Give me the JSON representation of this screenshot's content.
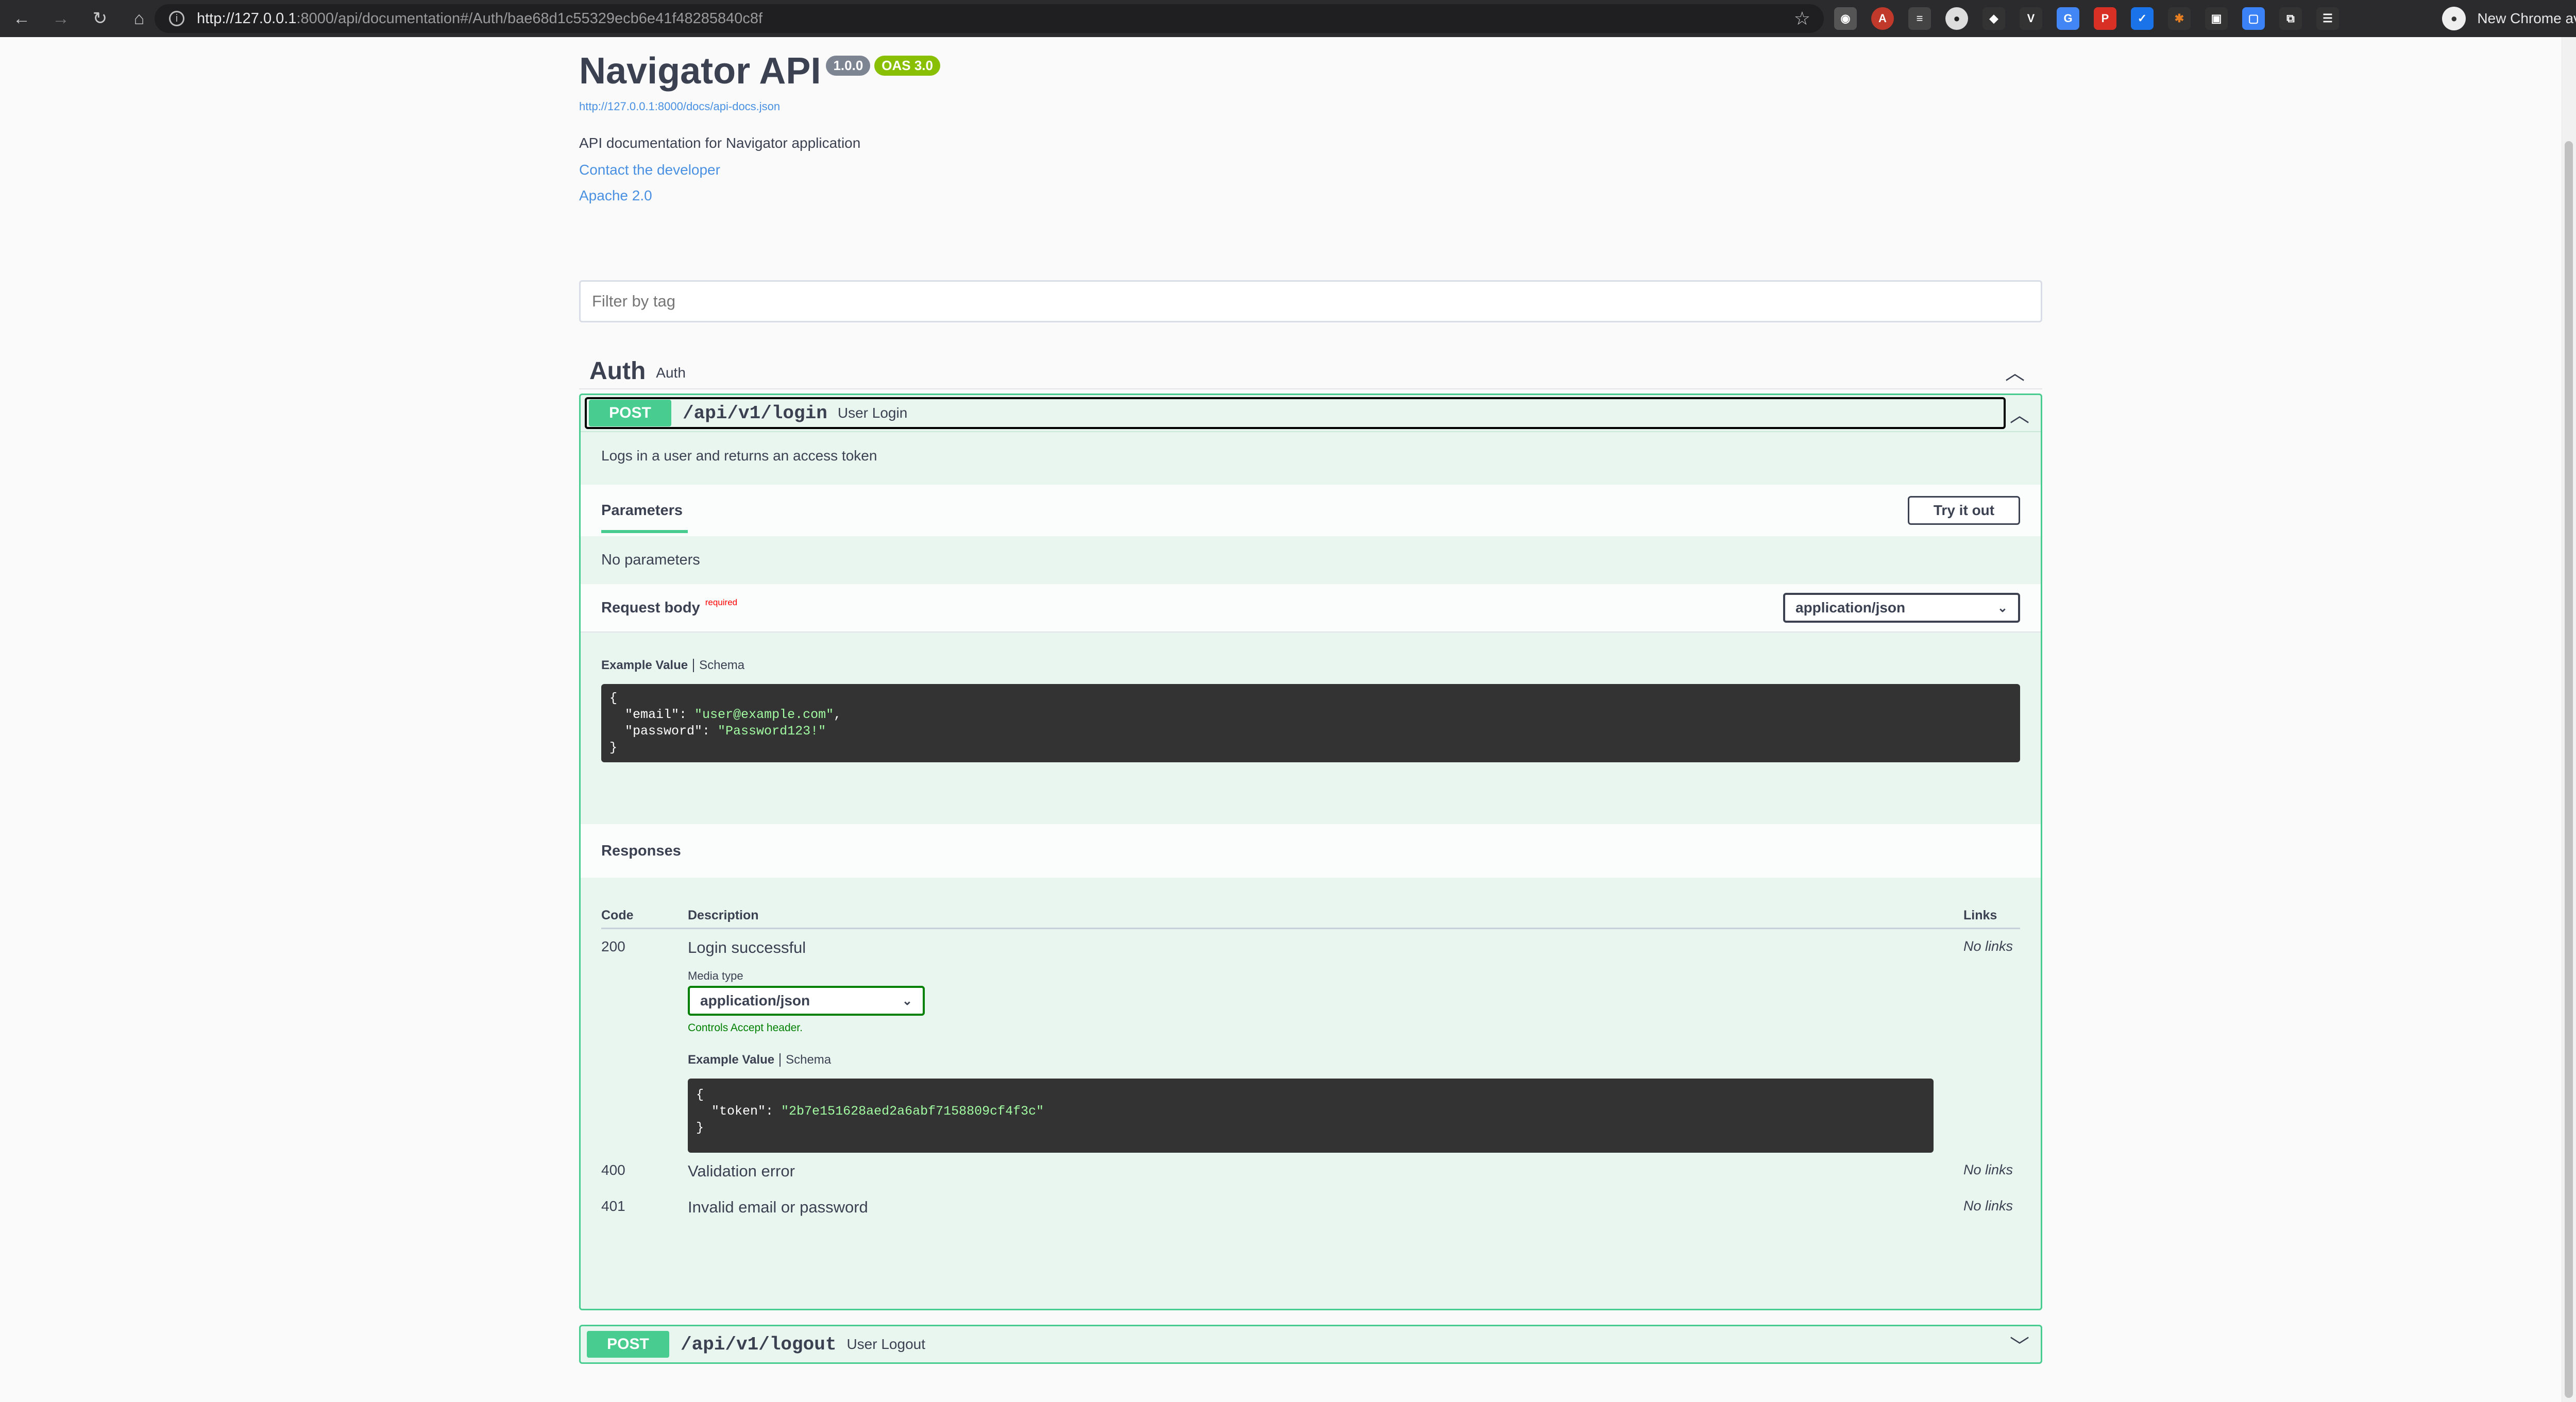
{
  "browser": {
    "url_host": "http://127.0.0.1",
    "url_rest": ":8000/api/documentation#/Auth/bae68d1c55329ecb6e41f48285840c8f",
    "new_chrome": "New Chrome available"
  },
  "info": {
    "title": "Navigator API",
    "version": "1.0.0",
    "oas": "OAS 3.0",
    "spec_link": "http://127.0.0.1:8000/docs/api-docs.json",
    "description": "API documentation for Navigator application",
    "contact": "Contact the developer",
    "license": "Apache 2.0"
  },
  "filter": {
    "placeholder": "Filter by tag"
  },
  "tag": {
    "name": "Auth",
    "description": "Auth"
  },
  "login": {
    "method": "POST",
    "path": "/api/v1/login",
    "summary": "User Login",
    "description": "Logs in a user and returns an access token",
    "params_tab": "Parameters",
    "try_label": "Try it out",
    "no_params": "No parameters",
    "request_body": "Request body",
    "required": "required",
    "content_type": "application/json",
    "example_value": "Example Value",
    "schema": "Schema",
    "request_example": {
      "open": "{",
      "email_key": "\"email\": ",
      "email_val": "\"user@example.com\"",
      "password_key": "\"password\": ",
      "password_val": "\"Password123!\"",
      "close": "}"
    },
    "responses_title": "Responses",
    "col_code": "Code",
    "col_description": "Description",
    "col_links": "Links",
    "responses": [
      {
        "code": "200",
        "description": "Login successful",
        "links": "No links"
      },
      {
        "code": "400",
        "description": "Validation error",
        "links": "No links"
      },
      {
        "code": "401",
        "description": "Invalid email or password",
        "links": "No links"
      }
    ],
    "media_type_label": "Media type",
    "media_type": "application/json",
    "controls_note": "Controls Accept header.",
    "response_example": {
      "open": "{",
      "token_key": "\"token\": ",
      "token_val": "\"2b7e151628aed2a6abf7158809cf4f3c\"",
      "close": "}"
    }
  },
  "logout": {
    "method": "POST",
    "path": "/api/v1/logout",
    "summary": "User Logout"
  }
}
